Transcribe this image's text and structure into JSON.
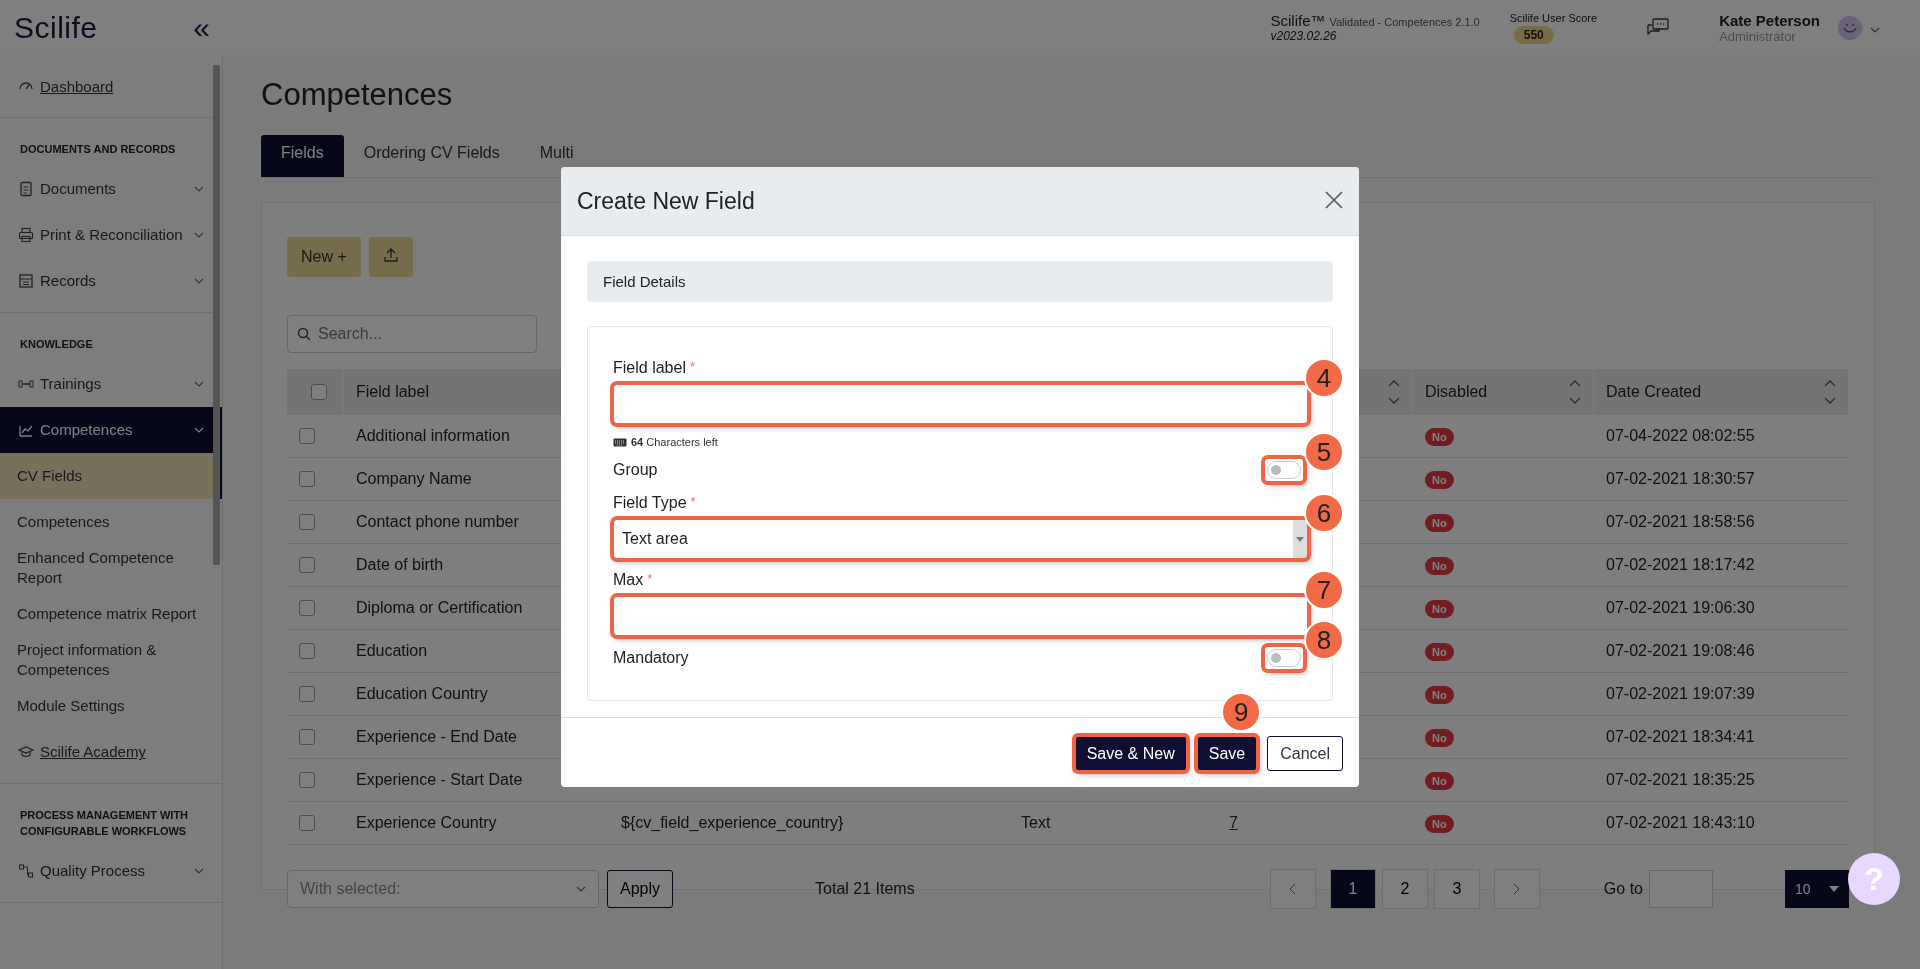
{
  "sidebar": {
    "logo": "Scilife",
    "collapse": "«",
    "sections": [
      {
        "items": [
          {
            "label": "Dashboard",
            "kind": "link",
            "selected": false
          }
        ]
      },
      {
        "title": "DOCUMENTS AND RECORDS",
        "items": [
          {
            "label": "Documents",
            "kind": "group",
            "selected": false
          },
          {
            "label": "Print & Reconciliation",
            "kind": "group",
            "selected": false
          },
          {
            "label": "Records",
            "kind": "group",
            "selected": false
          }
        ]
      },
      {
        "title": "KNOWLEDGE",
        "items": [
          {
            "label": "Trainings",
            "kind": "group",
            "selected": false
          },
          {
            "label": "Competences",
            "kind": "group",
            "selected": true
          },
          {
            "label": "CV Fields",
            "kind": "sub",
            "selected": true
          },
          {
            "label": "Competences",
            "kind": "sub",
            "selected": false
          },
          {
            "label": "Enhanced Competence Report",
            "kind": "sub",
            "selected": false
          },
          {
            "label": "Competence matrix Report",
            "kind": "sub",
            "selected": false
          },
          {
            "label": "Project information & Competences",
            "kind": "sub",
            "selected": false
          },
          {
            "label": "Module Settings",
            "kind": "sub",
            "selected": false
          },
          {
            "label": "Scilife Academy",
            "kind": "link",
            "selected": false
          }
        ]
      },
      {
        "title": "PROCESS MANAGEMENT WITH CONFIGURABLE WORKFLOWS",
        "items": [
          {
            "label": "Quality Process",
            "kind": "group",
            "selected": false
          }
        ]
      }
    ]
  },
  "header": {
    "product": "Scilife™",
    "edition": "Validated - Competences 2.1.0",
    "version": "v2023.02.26",
    "score_label": "Scilife User Score",
    "score": "550",
    "user_name": "Kate Peterson",
    "user_role": "Administrator"
  },
  "page": {
    "title": "Competences",
    "tabs": [
      {
        "label": "Fields",
        "selected": true
      },
      {
        "label": "Ordering CV Fields",
        "selected": false
      },
      {
        "label": "Multi",
        "selected": false
      }
    ],
    "new_button": "New +",
    "search": {
      "placeholder": "Search..."
    },
    "table": {
      "select_all_checked": false,
      "columns": [
        {
          "label": "Field label"
        },
        {
          "sortable": true
        },
        {
          "label": "Disabled",
          "sortable": true
        },
        {
          "label": "Date Created",
          "sortable": true
        }
      ],
      "rows": [
        {
          "checked": false,
          "field_label": "Additional information",
          "disabled": "No",
          "date_created": "07-04-2022 08:02:55"
        },
        {
          "checked": false,
          "field_label": "Company Name",
          "disabled": "No",
          "date_created": "07-02-2021 18:30:57"
        },
        {
          "checked": false,
          "field_label": "Contact phone number",
          "disabled": "No",
          "date_created": "07-02-2021 18:58:56"
        },
        {
          "checked": false,
          "field_label": "Date of birth",
          "disabled": "No",
          "date_created": "07-02-2021 18:17:42"
        },
        {
          "checked": false,
          "field_label": "Diploma or Certification",
          "disabled": "No",
          "date_created": "07-02-2021 19:06:30"
        },
        {
          "checked": false,
          "field_label": "Education",
          "disabled": "No",
          "date_created": "07-02-2021 19:08:46"
        },
        {
          "checked": false,
          "field_label": "Education Country",
          "disabled": "No",
          "date_created": "07-02-2021 19:07:39"
        },
        {
          "checked": false,
          "field_label": "Experience - End Date",
          "disabled": "No",
          "date_created": "07-02-2021 18:34:41"
        },
        {
          "checked": false,
          "field_label": "Experience - Start Date",
          "disabled": "No",
          "date_created": "07-02-2021 18:35:25"
        },
        {
          "checked": false,
          "field_label": "Experience Country",
          "column_3": "${cv_field_experience_country}",
          "column_4": "Text",
          "column_5": "7",
          "disabled": "No",
          "date_created": "07-02-2021 18:43:10"
        }
      ]
    },
    "footer": {
      "bulk_placeholder": "With selected:",
      "apply": "Apply",
      "total": "Total 21 Items",
      "pages": [
        {
          "label": "1",
          "selected": true
        },
        {
          "label": "2",
          "selected": false
        },
        {
          "label": "3",
          "selected": false
        }
      ],
      "goto": "Go to",
      "page_size": "10",
      "help": "?"
    }
  },
  "modal": {
    "title": "Create New Field",
    "section": "Field Details",
    "fields": [
      {
        "kind": "text",
        "label": "Field label",
        "required_mark": "*",
        "hint": "**64** Characters left",
        "highlighted": true,
        "marker": "4"
      },
      {
        "kind": "toggle",
        "label": "Group",
        "on": false,
        "highlighted": true,
        "marker": "5"
      },
      {
        "kind": "select",
        "label": "Field Type",
        "required_mark": "*",
        "value": "Text area",
        "highlighted": true,
        "marker": "6"
      },
      {
        "kind": "text",
        "label": "Max",
        "required_mark": "*",
        "highlighted": true,
        "marker": "7"
      },
      {
        "kind": "toggle",
        "label": "Mandatory",
        "on": false,
        "highlighted": true,
        "marker": "8"
      }
    ],
    "buttons": [
      {
        "label": "Save & New",
        "kind": "primary",
        "highlighted": true
      },
      {
        "label": "Save",
        "kind": "primary",
        "highlighted": true,
        "marker": "9"
      },
      {
        "label": "Cancel",
        "kind": "secondary",
        "highlighted": false
      }
    ]
  }
}
